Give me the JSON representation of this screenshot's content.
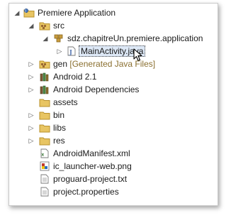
{
  "tree": {
    "project": {
      "label": "Premiere Application"
    },
    "src": {
      "label": "src"
    },
    "package": {
      "label": "sdz.chapitreUn.premiere.application"
    },
    "main_activity": {
      "label": "MainActivity.java"
    },
    "gen": {
      "label": "gen",
      "decoration": "[Generated Java Files]"
    },
    "android": {
      "label": "Android 2.1"
    },
    "android_deps": {
      "label": "Android Dependencies"
    },
    "assets": {
      "label": "assets"
    },
    "bin": {
      "label": "bin"
    },
    "libs": {
      "label": "libs"
    },
    "res": {
      "label": "res"
    },
    "manifest": {
      "label": "AndroidManifest.xml"
    },
    "launcher": {
      "label": "ic_launcher-web.png"
    },
    "proguard": {
      "label": "proguard-project.txt"
    },
    "properties": {
      "label": "project.properties"
    }
  },
  "colors": {
    "folder": "#e8c563",
    "folder_dark": "#b8912d",
    "selection_bg": "#dde8f6",
    "decoration": "#8a6f2f"
  },
  "icons": {
    "twisty_expanded": "triangle-down-icon",
    "twisty_collapsed": "triangle-right-icon"
  }
}
